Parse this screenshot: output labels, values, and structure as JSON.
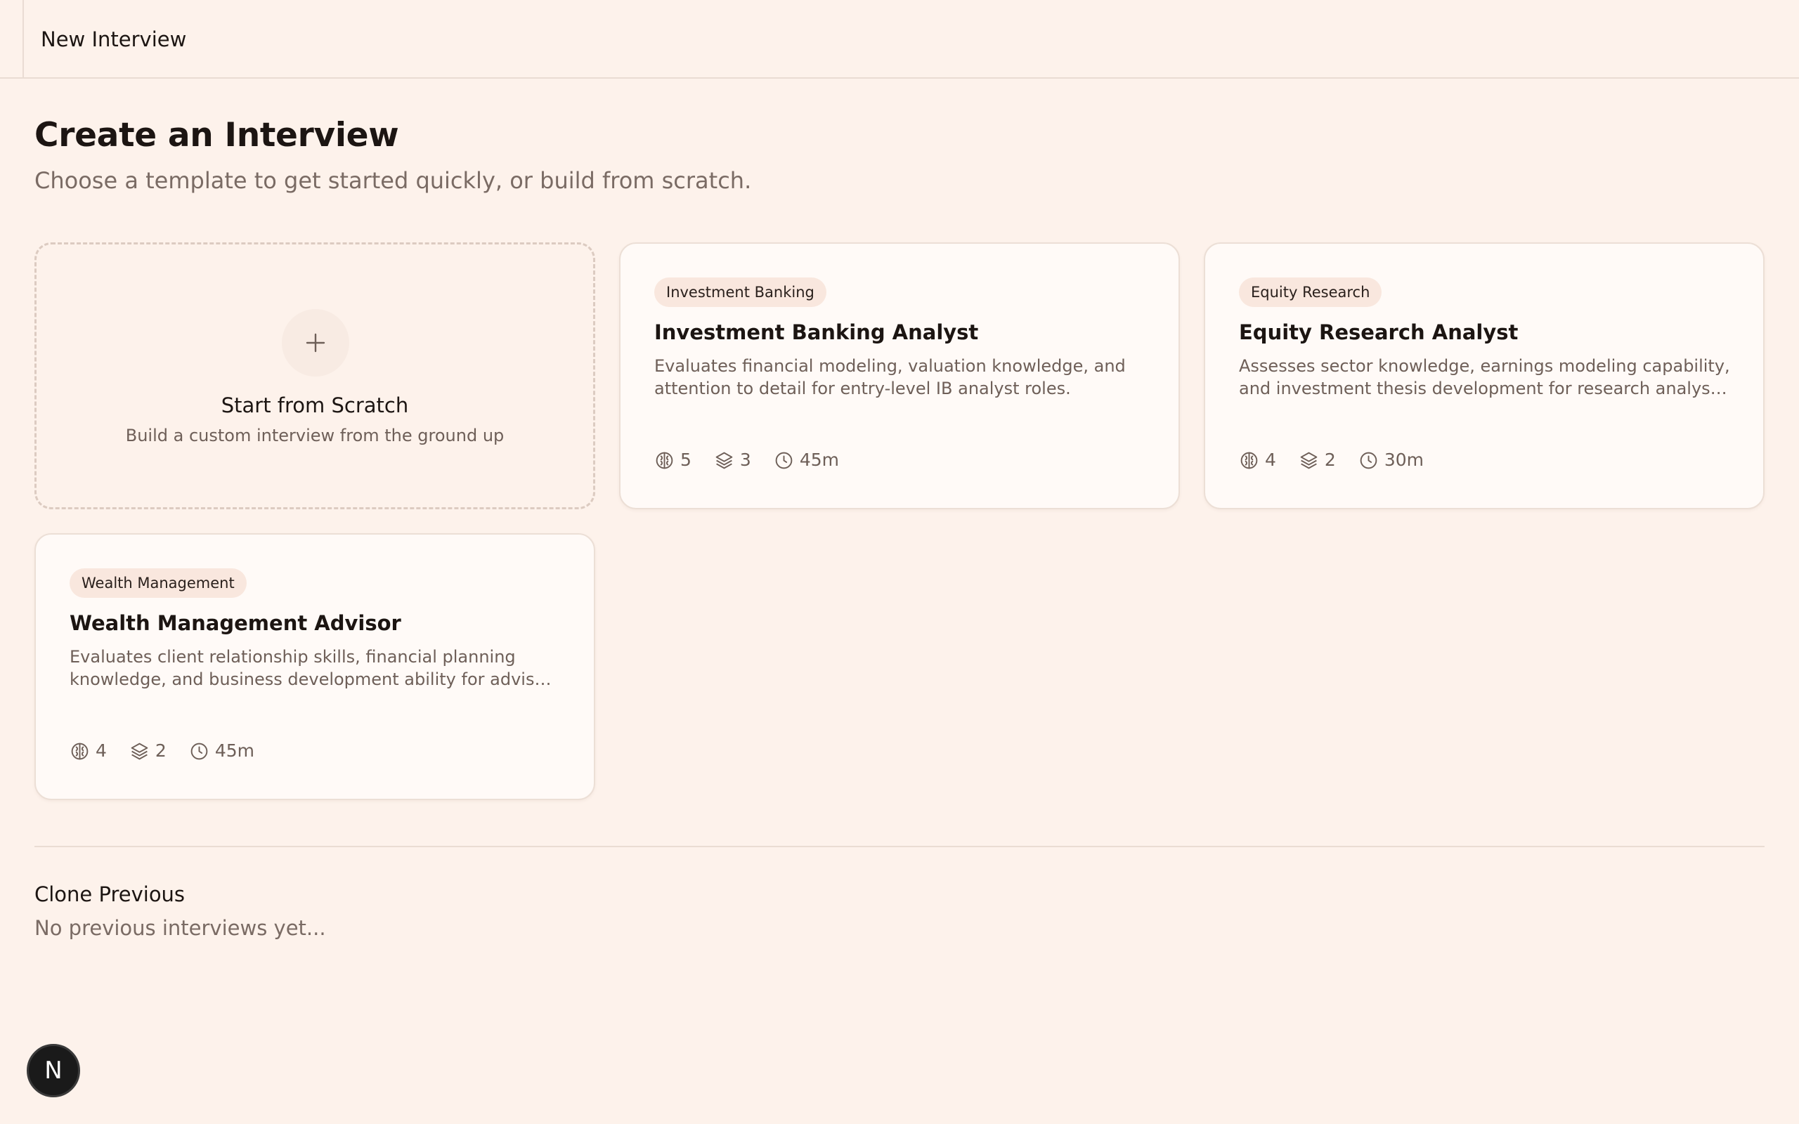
{
  "header": {
    "title": "New Interview"
  },
  "page": {
    "title": "Create an Interview",
    "subtitle": "Choose a template to get started quickly, or build from scratch."
  },
  "scratch": {
    "title": "Start from Scratch",
    "subtitle": "Build a custom interview from the ground up"
  },
  "templates": [
    {
      "tag": "Investment Banking",
      "title": "Investment Banking Analyst",
      "description": "Evaluates financial modeling, valuation knowledge, and attention to detail for entry-level IB analyst roles.",
      "competencies": "5",
      "sections": "3",
      "duration": "45m"
    },
    {
      "tag": "Equity Research",
      "title": "Equity Research Analyst",
      "description": "Assesses sector knowledge, earnings modeling capability, and investment thesis development for research analyst roles.",
      "competencies": "4",
      "sections": "2",
      "duration": "30m"
    },
    {
      "tag": "Wealth Management",
      "title": "Wealth Management Advisor",
      "description": "Evaluates client relationship skills, financial planning knowledge, and business development ability for advisor roles.",
      "competencies": "4",
      "sections": "2",
      "duration": "45m"
    }
  ],
  "clone": {
    "title": "Clone Previous",
    "empty": "No previous interviews yet..."
  },
  "badge": {
    "label": "N"
  }
}
